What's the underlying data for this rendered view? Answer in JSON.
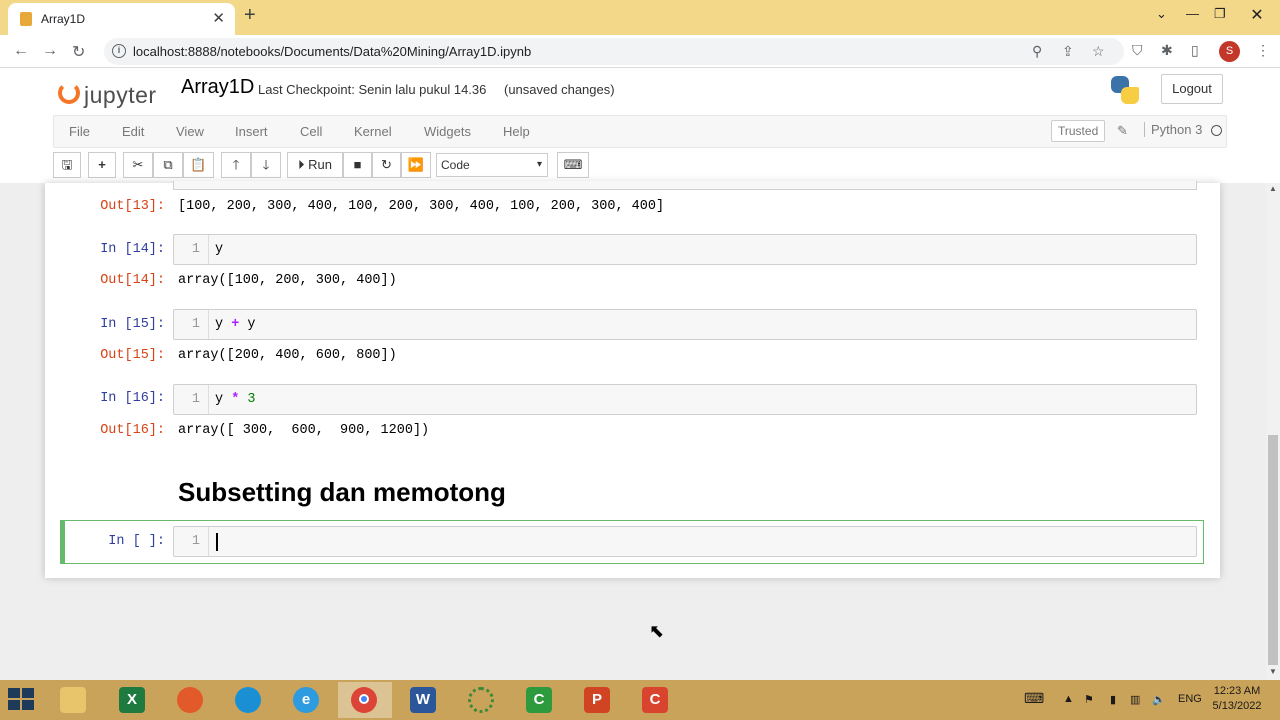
{
  "browser": {
    "tab_title": "Array1D",
    "url": "localhost:8888/notebooks/Documents/Data%20Mining/Array1D.ipynb",
    "profile_initial": "S"
  },
  "jupyter": {
    "logo_text": "jupyter",
    "notebook_name": "Array1D",
    "checkpoint": "Last Checkpoint: Senin lalu pukul 14.36",
    "unsaved": "(unsaved changes)",
    "logout_label": "Logout",
    "menu": [
      "File",
      "Edit",
      "View",
      "Insert",
      "Cell",
      "Kernel",
      "Widgets",
      "Help"
    ],
    "trusted_label": "Trusted",
    "kernel_name": "Python 3",
    "run_label": "Run",
    "cell_type": "Code"
  },
  "cells": {
    "out13_prompt": "Out[13]:",
    "out13_text": "[100, 200, 300, 400, 100, 200, 300, 400, 100, 200, 300, 400]",
    "in14_prompt": "In [14]:",
    "in14_line": "1",
    "in14_code": "y",
    "out14_prompt": "Out[14]:",
    "out14_text": "array([100, 200, 300, 400])",
    "in15_prompt": "In [15]:",
    "in15_line": "1",
    "in15_code_a": "y ",
    "in15_code_op": "+",
    "in15_code_b": " y",
    "out15_prompt": "Out[15]:",
    "out15_text": "array([200, 400, 600, 800])",
    "in16_prompt": "In [16]:",
    "in16_line": "1",
    "in16_code_a": "y ",
    "in16_code_op": "*",
    "in16_code_num": "3",
    "out16_prompt": "Out[16]:",
    "out16_text": "array([ 300,  600,  900, 1200])",
    "heading": "Subsetting dan memotong",
    "active_prompt": "In [ ]:",
    "active_line": "1"
  },
  "taskbar": {
    "lang": "ENG",
    "time": "12:23 AM",
    "date": "5/13/2022"
  }
}
